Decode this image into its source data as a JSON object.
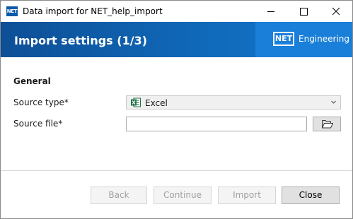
{
  "window": {
    "title": "Data import for NET_help_import",
    "app_icon_text": "NET"
  },
  "banner": {
    "title": "Import settings (1/3)",
    "logo_box_text": "NET",
    "logo_text": "Engineering",
    "colors": {
      "banner": "#1068b8",
      "logo_panel": "#1a7fd8"
    }
  },
  "form": {
    "section_title": "General",
    "source_type": {
      "label": "Source type*",
      "selected": "Excel",
      "icon": "excel-icon"
    },
    "source_file": {
      "label": "Source file*",
      "value": "",
      "placeholder": "",
      "browse_icon": "folder-open-icon"
    }
  },
  "footer": {
    "back_label": "Back",
    "continue_label": "Continue",
    "import_label": "Import",
    "close_label": "Close"
  }
}
